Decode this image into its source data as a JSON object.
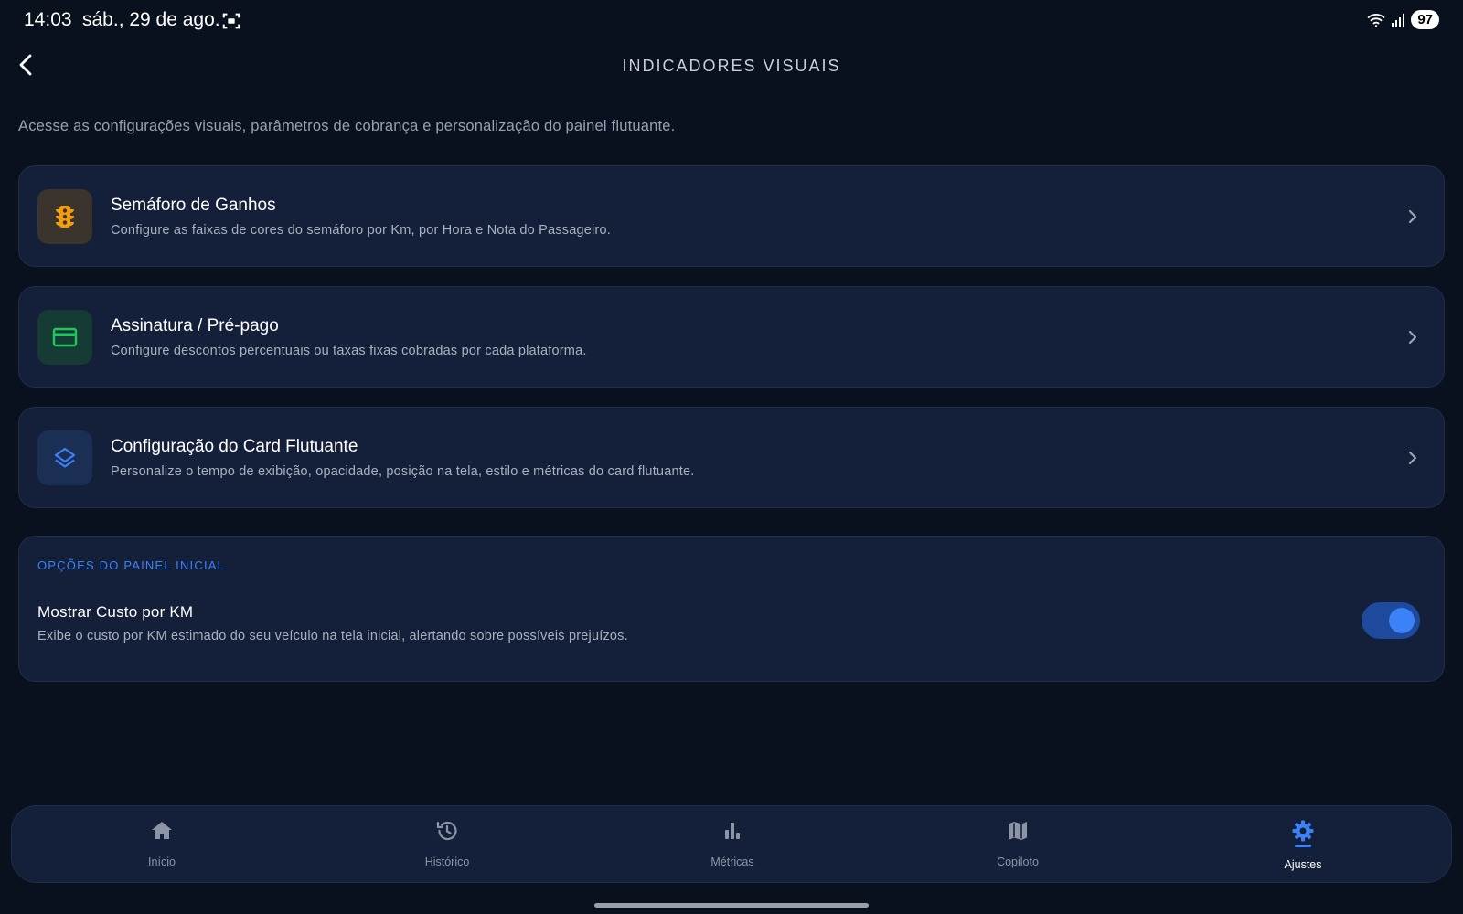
{
  "status_bar": {
    "time": "14:03",
    "date": "sáb., 29 de ago.",
    "battery": "97"
  },
  "header": {
    "title": "INDICADORES VISUAIS",
    "description": "Acesse as configurações visuais, parâmetros de cobrança e personalização do painel flutuante."
  },
  "cards": [
    {
      "title": "Semáforo de Ganhos",
      "subtitle": "Configure as faixas de cores do semáforo por Km, por Hora e Nota do Passageiro.",
      "icon": "traffic-light-icon",
      "icon_color": "#f59e0b"
    },
    {
      "title": "Assinatura / Pré-pago",
      "subtitle": "Configure descontos percentuais ou taxas fixas cobradas por cada plataforma.",
      "icon": "credit-card-icon",
      "icon_color": "#22c55e"
    },
    {
      "title": "Configuração do Card Flutuante",
      "subtitle": "Personalize o tempo de exibição, opacidade, posição na tela, estilo e métricas do card flutuante.",
      "icon": "layers-icon",
      "icon_color": "#3b82f6"
    }
  ],
  "options": {
    "heading": "OPÇÕES DO PAINEL INICIAL",
    "item": {
      "title": "Mostrar Custo por KM",
      "subtitle": "Exibe o custo por KM estimado do seu veículo na tela inicial, alertando sobre possíveis prejuízos.",
      "enabled": true
    }
  },
  "bottom_nav": {
    "items": [
      {
        "label": "Início",
        "icon": "home-icon"
      },
      {
        "label": "Histórico",
        "icon": "history-icon"
      },
      {
        "label": "Métricas",
        "icon": "bar-chart-icon"
      },
      {
        "label": "Copiloto",
        "icon": "map-icon"
      },
      {
        "label": "Ajustes",
        "icon": "gear-icon",
        "active": true
      }
    ]
  },
  "colors": {
    "accent": "#3b82f6",
    "background": "#0a111e",
    "card": "#14203a"
  }
}
